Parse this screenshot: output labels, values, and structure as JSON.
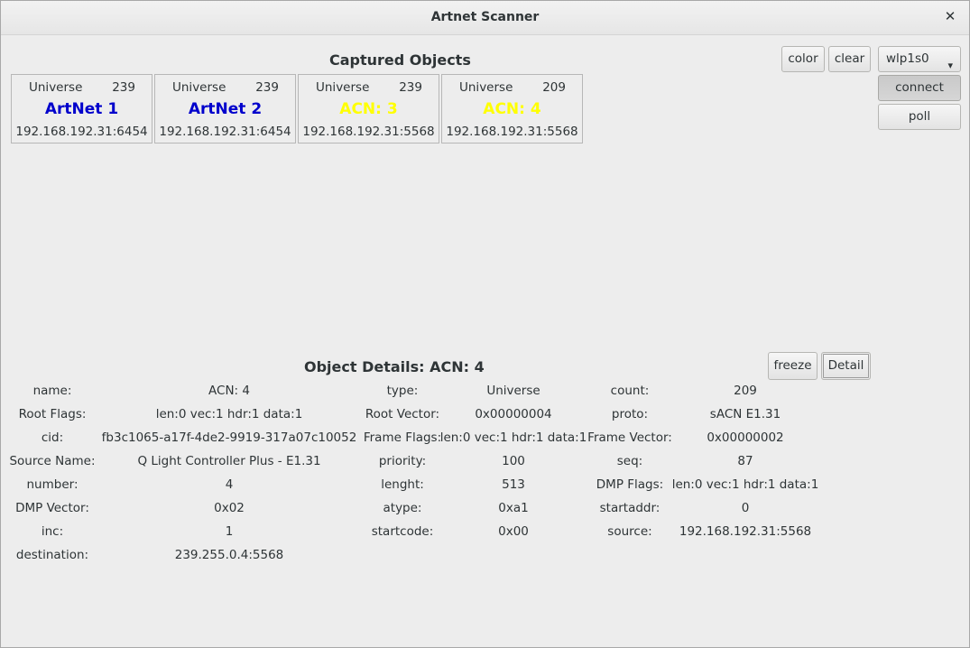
{
  "window": {
    "title": "Artnet Scanner",
    "close_glyph": "✕"
  },
  "captured": {
    "title": "Captured Objects",
    "cards": [
      {
        "universe_label": "Universe",
        "universe": "239",
        "name": "ArtNet 1",
        "address": "192.168.192.31:6454",
        "color": "#0000cc"
      },
      {
        "universe_label": "Universe",
        "universe": "239",
        "name": "ArtNet 2",
        "address": "192.168.192.31:6454",
        "color": "#0000cc"
      },
      {
        "universe_label": "Universe",
        "universe": "239",
        "name": "ACN: 3",
        "address": "192.168.192.31:5568",
        "color": "#ffff00"
      },
      {
        "universe_label": "Universe",
        "universe": "209",
        "name": "ACN: 4",
        "address": "192.168.192.31:5568",
        "color": "#ffff00"
      }
    ]
  },
  "toolbar": {
    "color_label": "color",
    "clear_label": "clear",
    "interface": "wlp1s0",
    "connect_label": "connect",
    "poll_label": "poll"
  },
  "details": {
    "title": "Object Details: ACN: 4",
    "freeze_label": "freeze",
    "detail_label": "Detail",
    "rows": [
      [
        "name:",
        "ACN: 4",
        "type:",
        "Universe",
        "count:",
        "209"
      ],
      [
        "Root Flags:",
        "len:0 vec:1 hdr:1 data:1",
        "Root Vector:",
        "0x00000004",
        "proto:",
        "sACN E1.31"
      ],
      [
        "cid:",
        "fb3c1065-a17f-4de2-9919-317a07c10052",
        "Frame Flags:",
        "len:0 vec:1 hdr:1 data:1",
        "Frame Vector:",
        "0x00000002"
      ],
      [
        "Source Name:",
        "Q Light Controller Plus - E1.31",
        "priority:",
        "100",
        "seq:",
        "87"
      ],
      [
        "number:",
        "4",
        "lenght:",
        "513",
        "DMP Flags:",
        "len:0 vec:1 hdr:1 data:1"
      ],
      [
        "DMP Vector:",
        "0x02",
        "atype:",
        "0xa1",
        "startaddr:",
        "0"
      ],
      [
        "inc:",
        "1",
        "startcode:",
        "0x00",
        "source:",
        "192.168.192.31:5568"
      ],
      [
        "destination:",
        "239.255.0.4:5568",
        "",
        "",
        "",
        ""
      ]
    ]
  }
}
